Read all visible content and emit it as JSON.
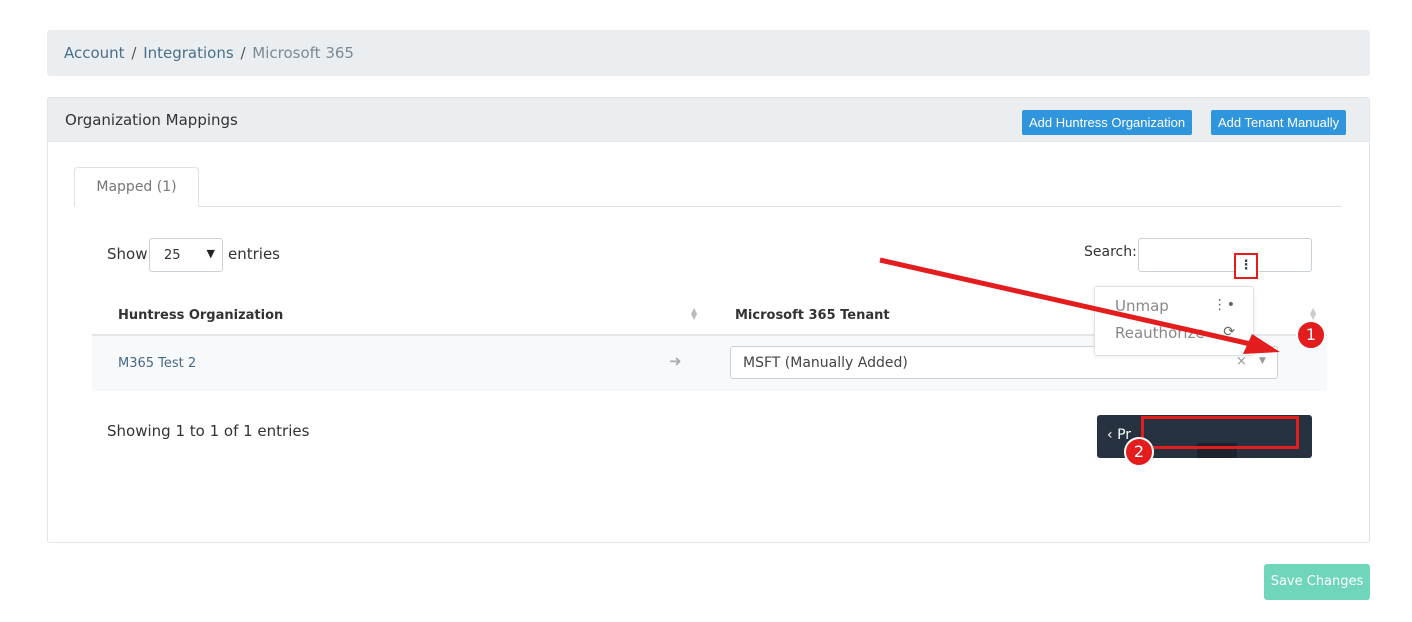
{
  "breadcrumb": {
    "items": [
      "Account",
      "Integrations"
    ],
    "separator": "/",
    "current": "Microsoft 365"
  },
  "panel": {
    "title": "Organization Mappings",
    "buttons": {
      "add_huntress": "Add Huntress Organization",
      "add_tenant": "Add Tenant Manually"
    }
  },
  "tabs": [
    {
      "label": "Mapped (1)",
      "active": true
    }
  ],
  "table_controls": {
    "show_label": "Show",
    "entries_value": "25",
    "entries_label": "entries",
    "search_label": "Search:",
    "search_value": ""
  },
  "table": {
    "columns": [
      "Huntress Organization",
      "Microsoft 365 Tenant"
    ],
    "rows": [
      {
        "organization": "M365 Test 2",
        "tenant": "MSFT (Manually Added)"
      }
    ]
  },
  "row_menu": {
    "items": [
      {
        "label": "Unmap",
        "icon": "unlink-icon"
      },
      {
        "label": "Reauthorize",
        "icon": "refresh-icon"
      }
    ]
  },
  "footer": {
    "showing": "Showing 1 to 1 of 1 entries",
    "pagination_prev": "Pr"
  },
  "annotations": {
    "badge1": "1",
    "badge2": "2",
    "color": "#e31d1d"
  },
  "save_button": "Save Changes",
  "colors": {
    "primary": "#2f95dc",
    "save": "#6fd6bc",
    "pagination": "#26323f"
  }
}
